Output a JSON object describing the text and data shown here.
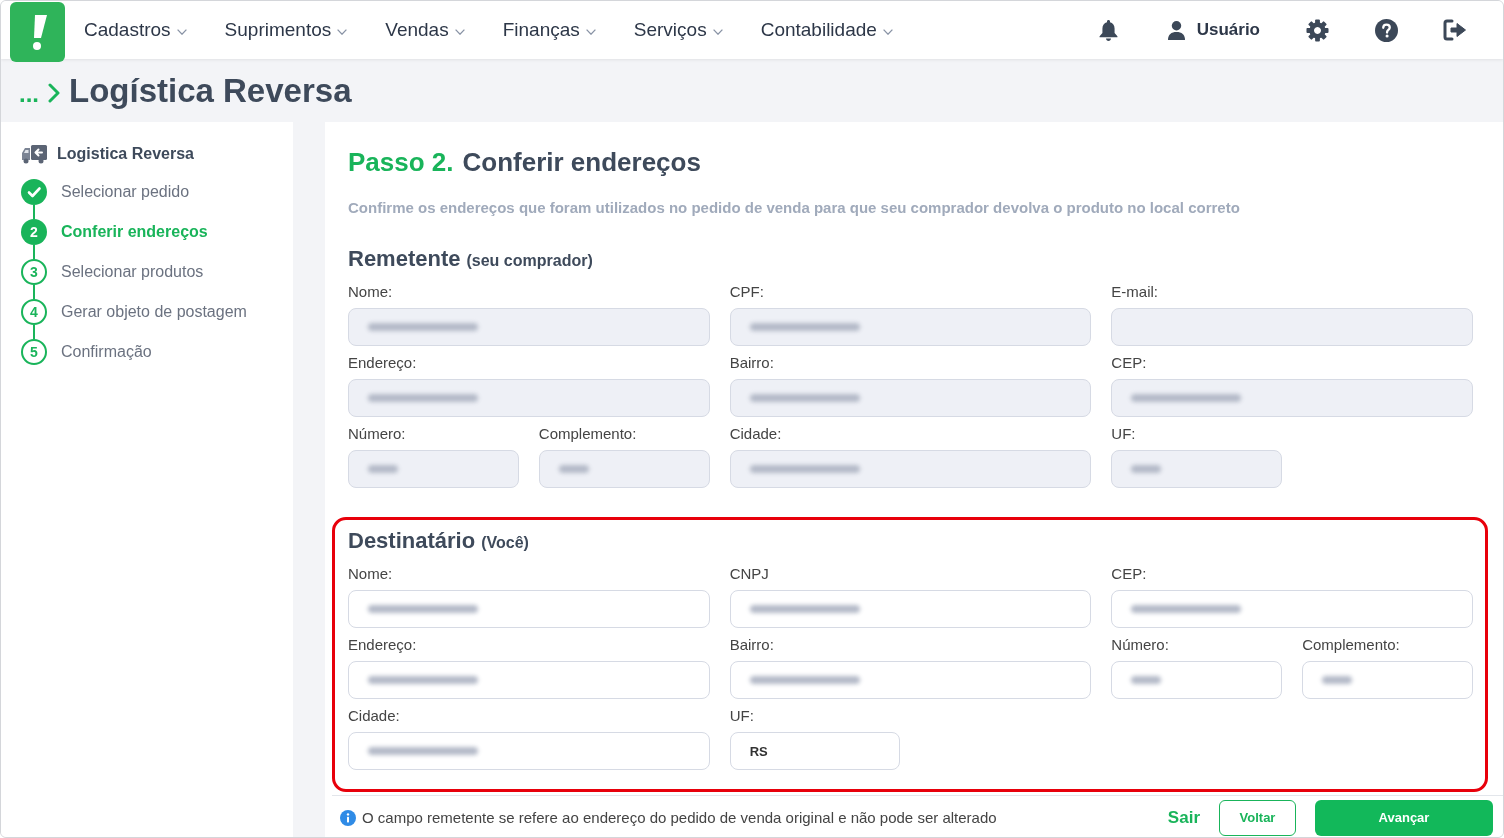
{
  "nav": {
    "menu": [
      {
        "label": "Cadastros"
      },
      {
        "label": "Suprimentos"
      },
      {
        "label": "Vendas"
      },
      {
        "label": "Finanças"
      },
      {
        "label": "Serviços"
      },
      {
        "label": "Contabilidade"
      }
    ],
    "user": "Usuário"
  },
  "breadcrumb": {
    "ellipsis": "...",
    "title": "Logística Reversa"
  },
  "sidebar": {
    "title": "Logistica Reversa",
    "steps": [
      {
        "label": "Selecionar pedido",
        "completed": true,
        "selected": false
      },
      {
        "number": "2",
        "label": "Conferir endereços",
        "completed": false,
        "selected": true
      },
      {
        "number": "3",
        "label": "Selecionar produtos",
        "completed": false,
        "selected": false
      },
      {
        "number": "4",
        "label": "Gerar objeto de postagem",
        "completed": false,
        "selected": false
      },
      {
        "number": "5",
        "label": "Confirmação",
        "completed": false,
        "selected": false
      }
    ]
  },
  "step": {
    "prefix": "Passo 2.",
    "title": "Conferir endereços",
    "description": "Confirme os endereços que foram utilizados no pedido de venda para que seu comprador devolva o produto no local correto"
  },
  "sections": [
    {
      "title": "Remetente",
      "subtitle": "(seu comprador)",
      "highlighted": false,
      "fields": [
        {
          "label": "Nome:",
          "kind": "wide",
          "disabled": true,
          "blurred": true
        },
        {
          "label": "CPF:",
          "kind": "wide",
          "disabled": true,
          "blurred": true
        },
        {
          "label": "E-mail:",
          "kind": "wide",
          "disabled": true,
          "blurred": false
        },
        {
          "label": "Endereço:",
          "kind": "wide",
          "disabled": true,
          "blurred": true
        },
        {
          "label": "Bairro:",
          "kind": "wide",
          "disabled": true,
          "blurred": true
        },
        {
          "label": "CEP:",
          "kind": "wide",
          "disabled": true,
          "blurred": true
        },
        {
          "label": "Número:",
          "kind": "narrow",
          "disabled": true,
          "blurred": true
        },
        {
          "label": "Complemento:",
          "kind": "narrow",
          "disabled": true,
          "blurred": true
        },
        {
          "label": "Cidade:",
          "kind": "wide",
          "disabled": true,
          "blurred": true
        },
        {
          "label": "UF:",
          "kind": "narrow",
          "disabled": true,
          "blurred": true
        }
      ]
    },
    {
      "title": "Destinatário",
      "subtitle": "(Você)",
      "highlighted": true,
      "fields": [
        {
          "label": "Nome:",
          "kind": "wide",
          "disabled": false,
          "blurred": true
        },
        {
          "label": "CNPJ",
          "kind": "wide",
          "disabled": false,
          "blurred": true
        },
        {
          "label": "CEP:",
          "kind": "wide",
          "disabled": false,
          "blurred": true
        },
        {
          "label": "Endereço:",
          "kind": "wide",
          "disabled": false,
          "blurred": true
        },
        {
          "label": "Bairro:",
          "kind": "wide",
          "disabled": false,
          "blurred": true
        },
        {
          "label": "Número:",
          "kind": "narrow",
          "disabled": false,
          "blurred": true
        },
        {
          "label": "Complemento:",
          "kind": "narrow",
          "disabled": false,
          "blurred": true
        },
        {
          "label": "Cidade:",
          "kind": "wide",
          "disabled": false,
          "blurred": true
        },
        {
          "label": "UF:",
          "kind": "narrow",
          "disabled": false,
          "blurred": false,
          "value": "RS"
        }
      ]
    }
  ],
  "footer": {
    "note": "O campo remetente se refere ao endereço do pedido de venda original e não pode ser alterado",
    "buttons": [
      {
        "label": "Sair",
        "kind": "link"
      },
      {
        "label": "Voltar",
        "kind": "outline"
      },
      {
        "label": "Avançar",
        "kind": "primary"
      }
    ]
  }
}
